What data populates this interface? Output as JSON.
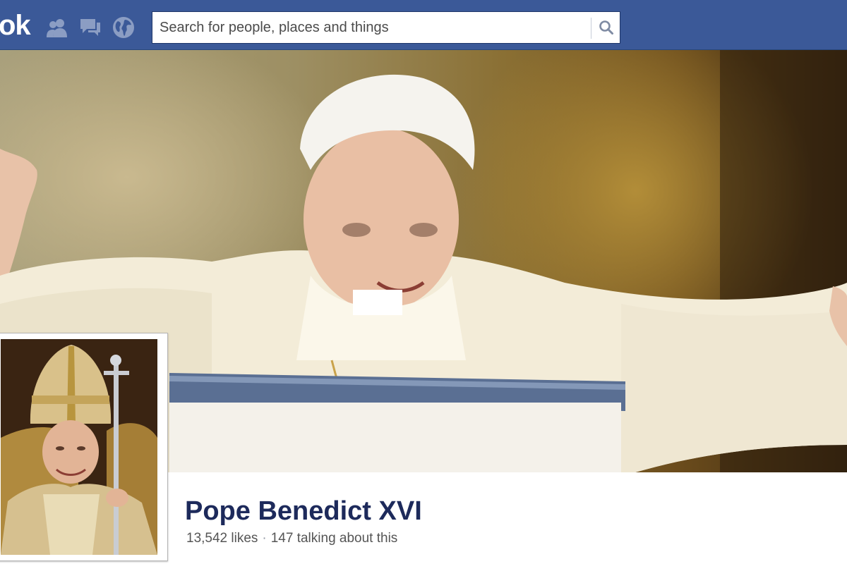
{
  "header": {
    "logo_text": "ok",
    "jewels": [
      {
        "icon": "friend-requests-icon"
      },
      {
        "icon": "messages-icon"
      },
      {
        "icon": "notifications-globe-icon"
      }
    ],
    "search": {
      "placeholder": "Search for people, places and things",
      "value": "",
      "button_icon": "search-icon"
    },
    "colors": {
      "bar": "#3b5998",
      "jewel": "#8b9dc3"
    }
  },
  "page": {
    "name": "Pope Benedict XVI",
    "likes": "13,542 likes",
    "separator": "·",
    "talking": "147 talking about this"
  }
}
